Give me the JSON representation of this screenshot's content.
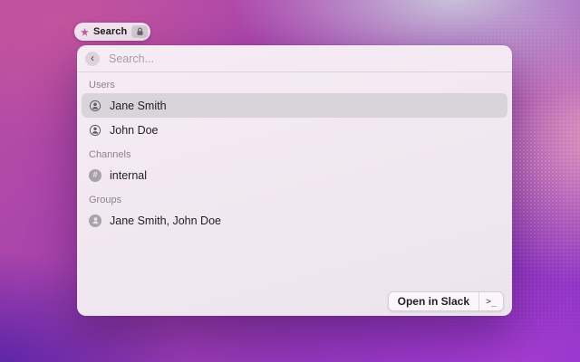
{
  "search_pill": {
    "label": "Search",
    "app_icon": "star-icon",
    "badge_icon": "lock-icon"
  },
  "panel": {
    "search_bar": {
      "back_glyph": "‹",
      "placeholder": "Search..."
    },
    "sections": [
      {
        "label": "Users",
        "items": [
          {
            "label": "Jane Smith",
            "icon": "user-icon",
            "selected": true
          },
          {
            "label": "John Doe",
            "icon": "user-icon",
            "selected": false
          }
        ]
      },
      {
        "label": "Channels",
        "hash_glyph": "#",
        "items": [
          {
            "label": "internal",
            "icon": "hash-icon",
            "selected": false
          }
        ]
      },
      {
        "label": "Groups",
        "items": [
          {
            "label": "Jane Smith, John Doe",
            "icon": "group-icon",
            "selected": false
          }
        ]
      }
    ],
    "footer": {
      "open_button_label": "Open in Slack",
      "shortcut_key": ">_"
    }
  },
  "colors": {
    "selection_highlight": "#d9d4da",
    "panel_background": "#f1e7f0",
    "wallpaper_magenta": "#bb4fa2",
    "wallpaper_violet": "#4a1da5",
    "wallpaper_purple": "#a63cd2",
    "wallpaper_lavender": "#c9c6db",
    "wallpaper_pink": "#e096ba"
  }
}
